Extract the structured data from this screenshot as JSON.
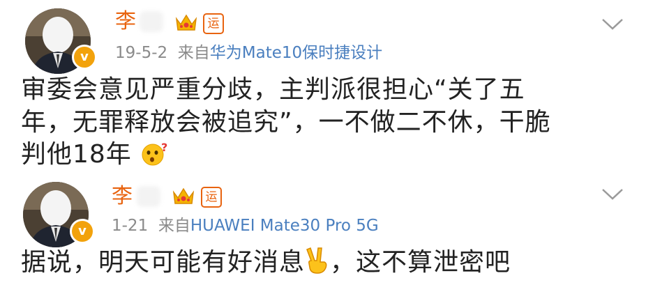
{
  "posts": [
    {
      "author": "李",
      "level_badge": "运",
      "verified_badge": "v",
      "date": "19-5-2",
      "from_label": "来自",
      "source": "华为Mate10保时捷设计",
      "lines": [
        "审委会意见严重分歧，主判派很担心“关了五",
        "年，无罪释放会被追究”，一不做二不休，干脆",
        "判他18年"
      ],
      "emoji": "surprised-face-icon"
    },
    {
      "author": "李",
      "level_badge": "运",
      "verified_badge": "v",
      "date": "1-21",
      "from_label": "来自",
      "source": "HUAWEI Mate30 Pro 5G",
      "text_before": "据说，明天可能有好消息",
      "text_after": "，这不算泄密吧",
      "emoji": "victory-hand-icon"
    }
  ],
  "colors": {
    "name": "#e8630f",
    "source": "#4a7fbf",
    "meta": "#8a8a8a",
    "badge": "#f2a20c"
  }
}
